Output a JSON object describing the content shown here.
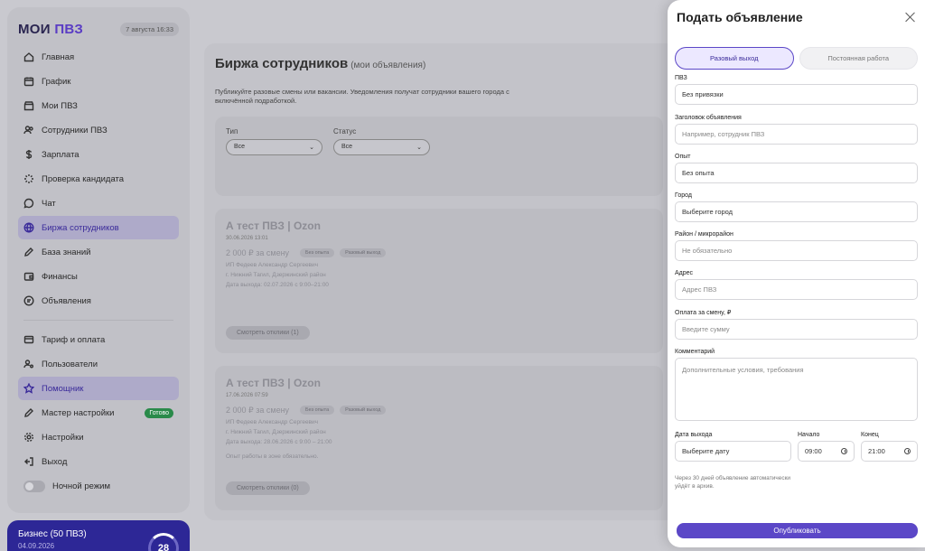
{
  "header": {
    "logo_main": "МОИ",
    "logo_accent": "ПВЗ",
    "date": "7 августа 16:33"
  },
  "sidebar": {
    "items": [
      {
        "label": "Главная"
      },
      {
        "label": "График"
      },
      {
        "label": "Мои ПВЗ"
      },
      {
        "label": "Сотрудники ПВЗ"
      },
      {
        "label": "Зарплата"
      },
      {
        "label": "Проверка кандидата"
      },
      {
        "label": "Чат"
      },
      {
        "label": "Биржа сотрудников"
      },
      {
        "label": "База знаний"
      },
      {
        "label": "Финансы"
      },
      {
        "label": "Объявления"
      },
      {
        "label": "Тариф и оплата"
      },
      {
        "label": "Пользователи"
      },
      {
        "label": "Помощник"
      },
      {
        "label": "Мастер настройки"
      },
      {
        "label": "Настройки"
      },
      {
        "label": "Выход"
      },
      {
        "label": "Ночной режим"
      }
    ],
    "ready_badge": "Готово"
  },
  "plan": {
    "title": "Бизнес (50 ПВЗ)",
    "date": "04.09.2026",
    "ring_value": "28"
  },
  "main": {
    "title": "Биржа сотрудников",
    "subtitle": "(мои объявления)",
    "description": "Публикуйте разовые смены или вакансии. Уведомления получат сотрудники вашего города с включённой подработкой.",
    "filters": {
      "type_label": "Тип",
      "type_value": "Все",
      "status_label": "Статус",
      "status_value": "Все"
    },
    "posts": [
      {
        "title": "А тест ПВЗ | Ozon",
        "date": "30.06.2026 13:01",
        "price": "2 000 ₽ за смену",
        "tags": [
          "Без опыта",
          "Разовый выход"
        ],
        "lines": [
          "ИП Федеев Александр Сергеевич",
          "г. Нижний Тагил, Дзержинский район",
          "Дата выхода: 02.07.2026 с 9:00–21:00"
        ],
        "button": "Смотреть отклики (1)"
      },
      {
        "title": "А тест ПВЗ | Ozon",
        "date": "17.06.2026 07:59",
        "price": "2 000 ₽ за смену",
        "tags": [
          "Без опыта",
          "Разовый выход"
        ],
        "lines": [
          "ИП Федеев Александр Сергеевич",
          "г. Нижний Тагил, Дзержинский район",
          "Дата выхода: 28.06.2026 с 9:00 – 21:00",
          "Опыт работы в зоне обязательно."
        ],
        "button": "Смотреть отклики (0)"
      }
    ]
  },
  "panel": {
    "title": "Подать объявление",
    "tabs": [
      "Разовый выход",
      "Постоянная работа"
    ],
    "fields": {
      "pvz_label": "ПВЗ",
      "pvz_value": "Без привязки",
      "title_label": "Заголовок объявления",
      "title_placeholder": "Например, сотрудник ПВЗ",
      "exp_label": "Опыт",
      "exp_value": "Без опыта",
      "city_label": "Город",
      "city_placeholder": "Выберите город",
      "district_label": "Район / микрорайон",
      "district_placeholder": "Не обязательно",
      "address_label": "Адрес",
      "address_placeholder": "Адрес ПВЗ",
      "pay_label": "Оплата за смену, ₽",
      "pay_placeholder": "Введите сумму",
      "comment_label": "Комментарий",
      "comment_placeholder": "Дополнительные условия, требования",
      "date_label": "Дата выхода",
      "date_placeholder": "Выберите дату",
      "start_label": "Начало",
      "start_value": "09:00",
      "end_label": "Конец",
      "end_value": "21:00"
    },
    "note": "Через 30 дней объявление автоматически уйдёт в архив.",
    "publish": "Опубликовать"
  }
}
